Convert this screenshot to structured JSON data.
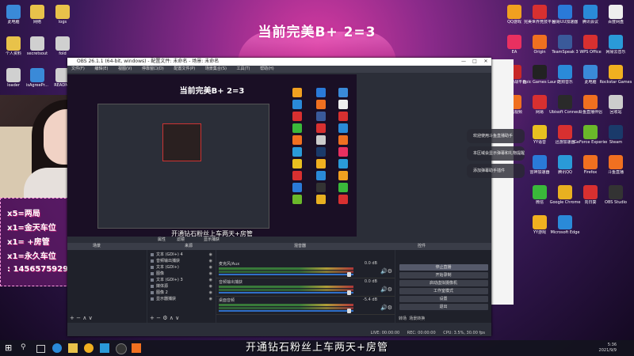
{
  "headline": "当前完美B+ 2=3",
  "subtitle": "开通钻石粉丝上车两天+房管",
  "preview": {
    "headline": "当前完美B+ 2=3",
    "caption": "开通钻石粉丝上车两天+房管"
  },
  "obs": {
    "title": "OBS 26.1.1 (64-bit, windows) - 配置文件: 未命名 - 场景: 未命名",
    "menu": [
      "文件(F)",
      "编辑(E)",
      "视图(V)",
      "停靠窗口(D)",
      "配置文件(P)",
      "场景集合(S)",
      "工具(T)",
      "帮助(H)"
    ],
    "tabs": {
      "properties": "属性",
      "filters": "滤镜",
      "display": "显示捕获"
    },
    "dock_headers": {
      "scenes": "场景",
      "sources": "来源",
      "mixer": "混音器",
      "transitions": "转场特效",
      "controls": "控件"
    },
    "sources": [
      "文本 (GDI+) 4",
      "音频输出捕获",
      "文本 (GDI+)",
      "图像",
      "文本 (GDI+) 3",
      "媒体源",
      "图像 2",
      "显示器捕获"
    ],
    "mixer": [
      {
        "label": "麦克风/Aux",
        "db": "0.0 dB"
      },
      {
        "label": "音频输出捕获",
        "db": "0.0 dB"
      },
      {
        "label": "桌面音频",
        "db": "-5.4 dB"
      }
    ],
    "controls": [
      "停止直播",
      "开始录制",
      "启动虚拟摄像机",
      "工作室模式",
      "设置",
      "退出"
    ],
    "bottom_tabs": [
      "转场",
      "场景转换"
    ],
    "status": [
      "LIVE: 00:00:00",
      "REC: 00:00:00",
      "CPU: 3.5%, 30.00 fps"
    ]
  },
  "overlay_lines": [
    "x5=两局",
    "x1=金天车位",
    "x1=  +房管",
    "x1=永久车位",
    ": 1456575929"
  ],
  "notifications": [
    "欢迎使用斗鱼直播助手",
    "本区域会显示弹幕和礼物提醒",
    "添加弹幕助手插件"
  ],
  "desktop_icons_left": [
    {
      "label": "此电脑",
      "color": "#3a8ad8"
    },
    {
      "label": "网络",
      "color": "#e8c24a"
    },
    {
      "label": "logs",
      "color": "#e8c24a"
    },
    {
      "label": "个人资料",
      "color": "#e8c24a"
    },
    {
      "label": "secretsout",
      "color": "#d0d0d0"
    },
    {
      "label": "fold",
      "color": "#d0d0d0"
    },
    {
      "label": "loader",
      "color": "#d0d0d0"
    },
    {
      "label": "isAgreePr...",
      "color": "#3a8ad8"
    },
    {
      "label": "README",
      "color": "#d0d0d0"
    }
  ],
  "desktop_icons_right": [
    {
      "label": "QQ游戏",
      "color": "#f0a020"
    },
    {
      "label": "完美世界竞技平台",
      "color": "#d83030"
    },
    {
      "label": "网易UU加速器",
      "color": "#2a7ad8"
    },
    {
      "label": "腾讯会议",
      "color": "#2a8ad8"
    },
    {
      "label": "百度网盘",
      "color": "#eeeeee"
    },
    {
      "label": "EA",
      "color": "#e83060"
    },
    {
      "label": "Origin",
      "color": "#f07020"
    },
    {
      "label": "TeamSpeak 3",
      "color": "#3a5a9a"
    },
    {
      "label": "WPS Office",
      "color": "#d83030"
    },
    {
      "label": "网易云音乐",
      "color": "#2a9ad8"
    },
    {
      "label": "完美对战平台",
      "color": "#c82828"
    },
    {
      "label": "Epic Games Launcher",
      "color": "#222222"
    },
    {
      "label": "酷狗音乐",
      "color": "#2a8ad8"
    },
    {
      "label": "此电脑",
      "color": "#3a8ad8"
    },
    {
      "label": "Rockstar Games",
      "color": "#f0b020"
    },
    {
      "label": "腾讯视频",
      "color": "#f07020"
    },
    {
      "label": "网易",
      "color": "#d83030"
    },
    {
      "label": "Ubisoft Connect",
      "color": "#2a2a2a"
    },
    {
      "label": "斗鱼直播伴侣",
      "color": "#f07020"
    },
    {
      "label": "回收站",
      "color": "#cccccc"
    },
    {
      "label": "YY语音",
      "color": "#e8c020"
    },
    {
      "label": "迅游加速器",
      "color": "#d83030"
    },
    {
      "label": "GeForce Experience",
      "color": "#6ab82a"
    },
    {
      "label": "Steam",
      "color": "#1a3a6a"
    },
    {
      "label": "雷神加速器",
      "color": "#2a7ad8"
    },
    {
      "label": "腾讯QQ",
      "color": "#2a9ad8"
    },
    {
      "label": "Firefox",
      "color": "#f07020"
    },
    {
      "label": "斗鱼直播",
      "color": "#f07020"
    },
    {
      "label": "微信",
      "color": "#3ab83a"
    },
    {
      "label": "Google Chrome",
      "color": "#e8b020"
    },
    {
      "label": "向日葵",
      "color": "#d83030"
    },
    {
      "label": "OBS Studio",
      "color": "#333333"
    },
    {
      "label": "YY游戏",
      "color": "#f0b020"
    },
    {
      "label": "Microsoft Edge",
      "color": "#2a8ad8"
    }
  ],
  "clock": {
    "time": "5:36",
    "date": "2021/9/9"
  }
}
